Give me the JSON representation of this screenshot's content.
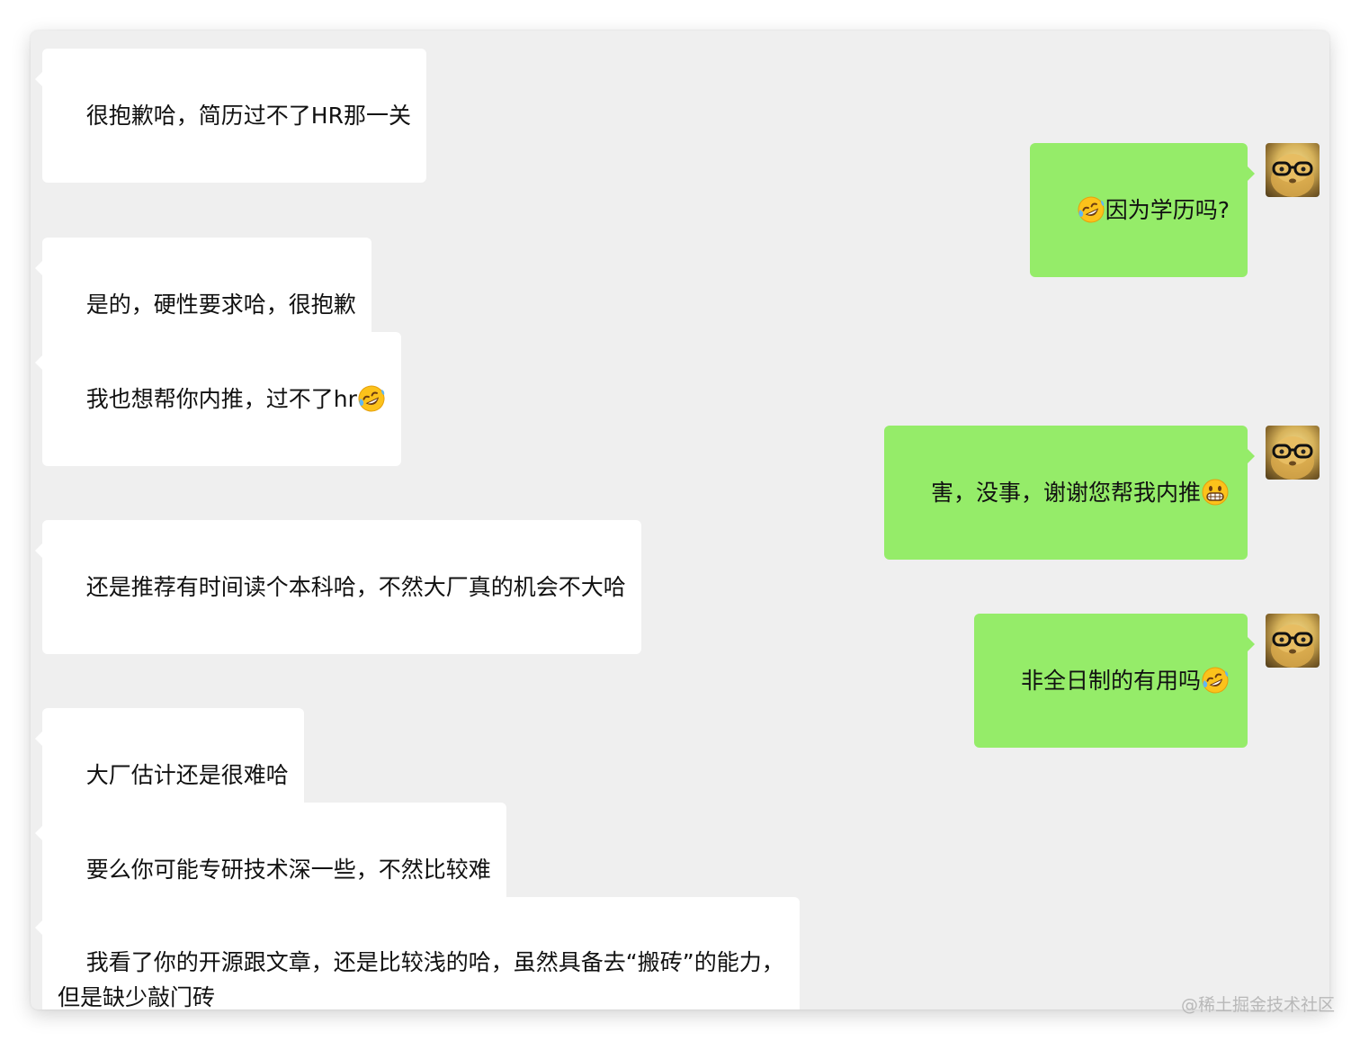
{
  "chat": {
    "m1": "很抱歉哈，简历过不了HR那一关",
    "m2": "因为学历吗?",
    "m3": "是的，硬性要求哈，很抱歉",
    "m4": "我也想帮你内推，过不了hr",
    "m5": "害，没事，谢谢您帮我内推",
    "m6": "还是推荐有时间读个本科哈，不然大厂真的机会不大哈",
    "m7": "非全日制的有用吗",
    "m8": "大厂估计还是很难哈",
    "m9": "要么你可能专研技术深一些，不然比较难",
    "m10": "我看了你的开源跟文章，还是比较浅的哈，虽然具备去“搬砖”的能力，\n但是缺少敲门砖"
  },
  "emoji": {
    "laugh_cry": "rolling-on-floor-laughing-icon",
    "grin": "grinning-face-icon"
  },
  "avatar": {
    "icon": "hamster-with-glasses-icon"
  },
  "watermark": "@稀土掘金技术社区",
  "colors": {
    "background": "#efefef",
    "incoming_bubble": "#ffffff",
    "outgoing_bubble": "#95ec69"
  }
}
